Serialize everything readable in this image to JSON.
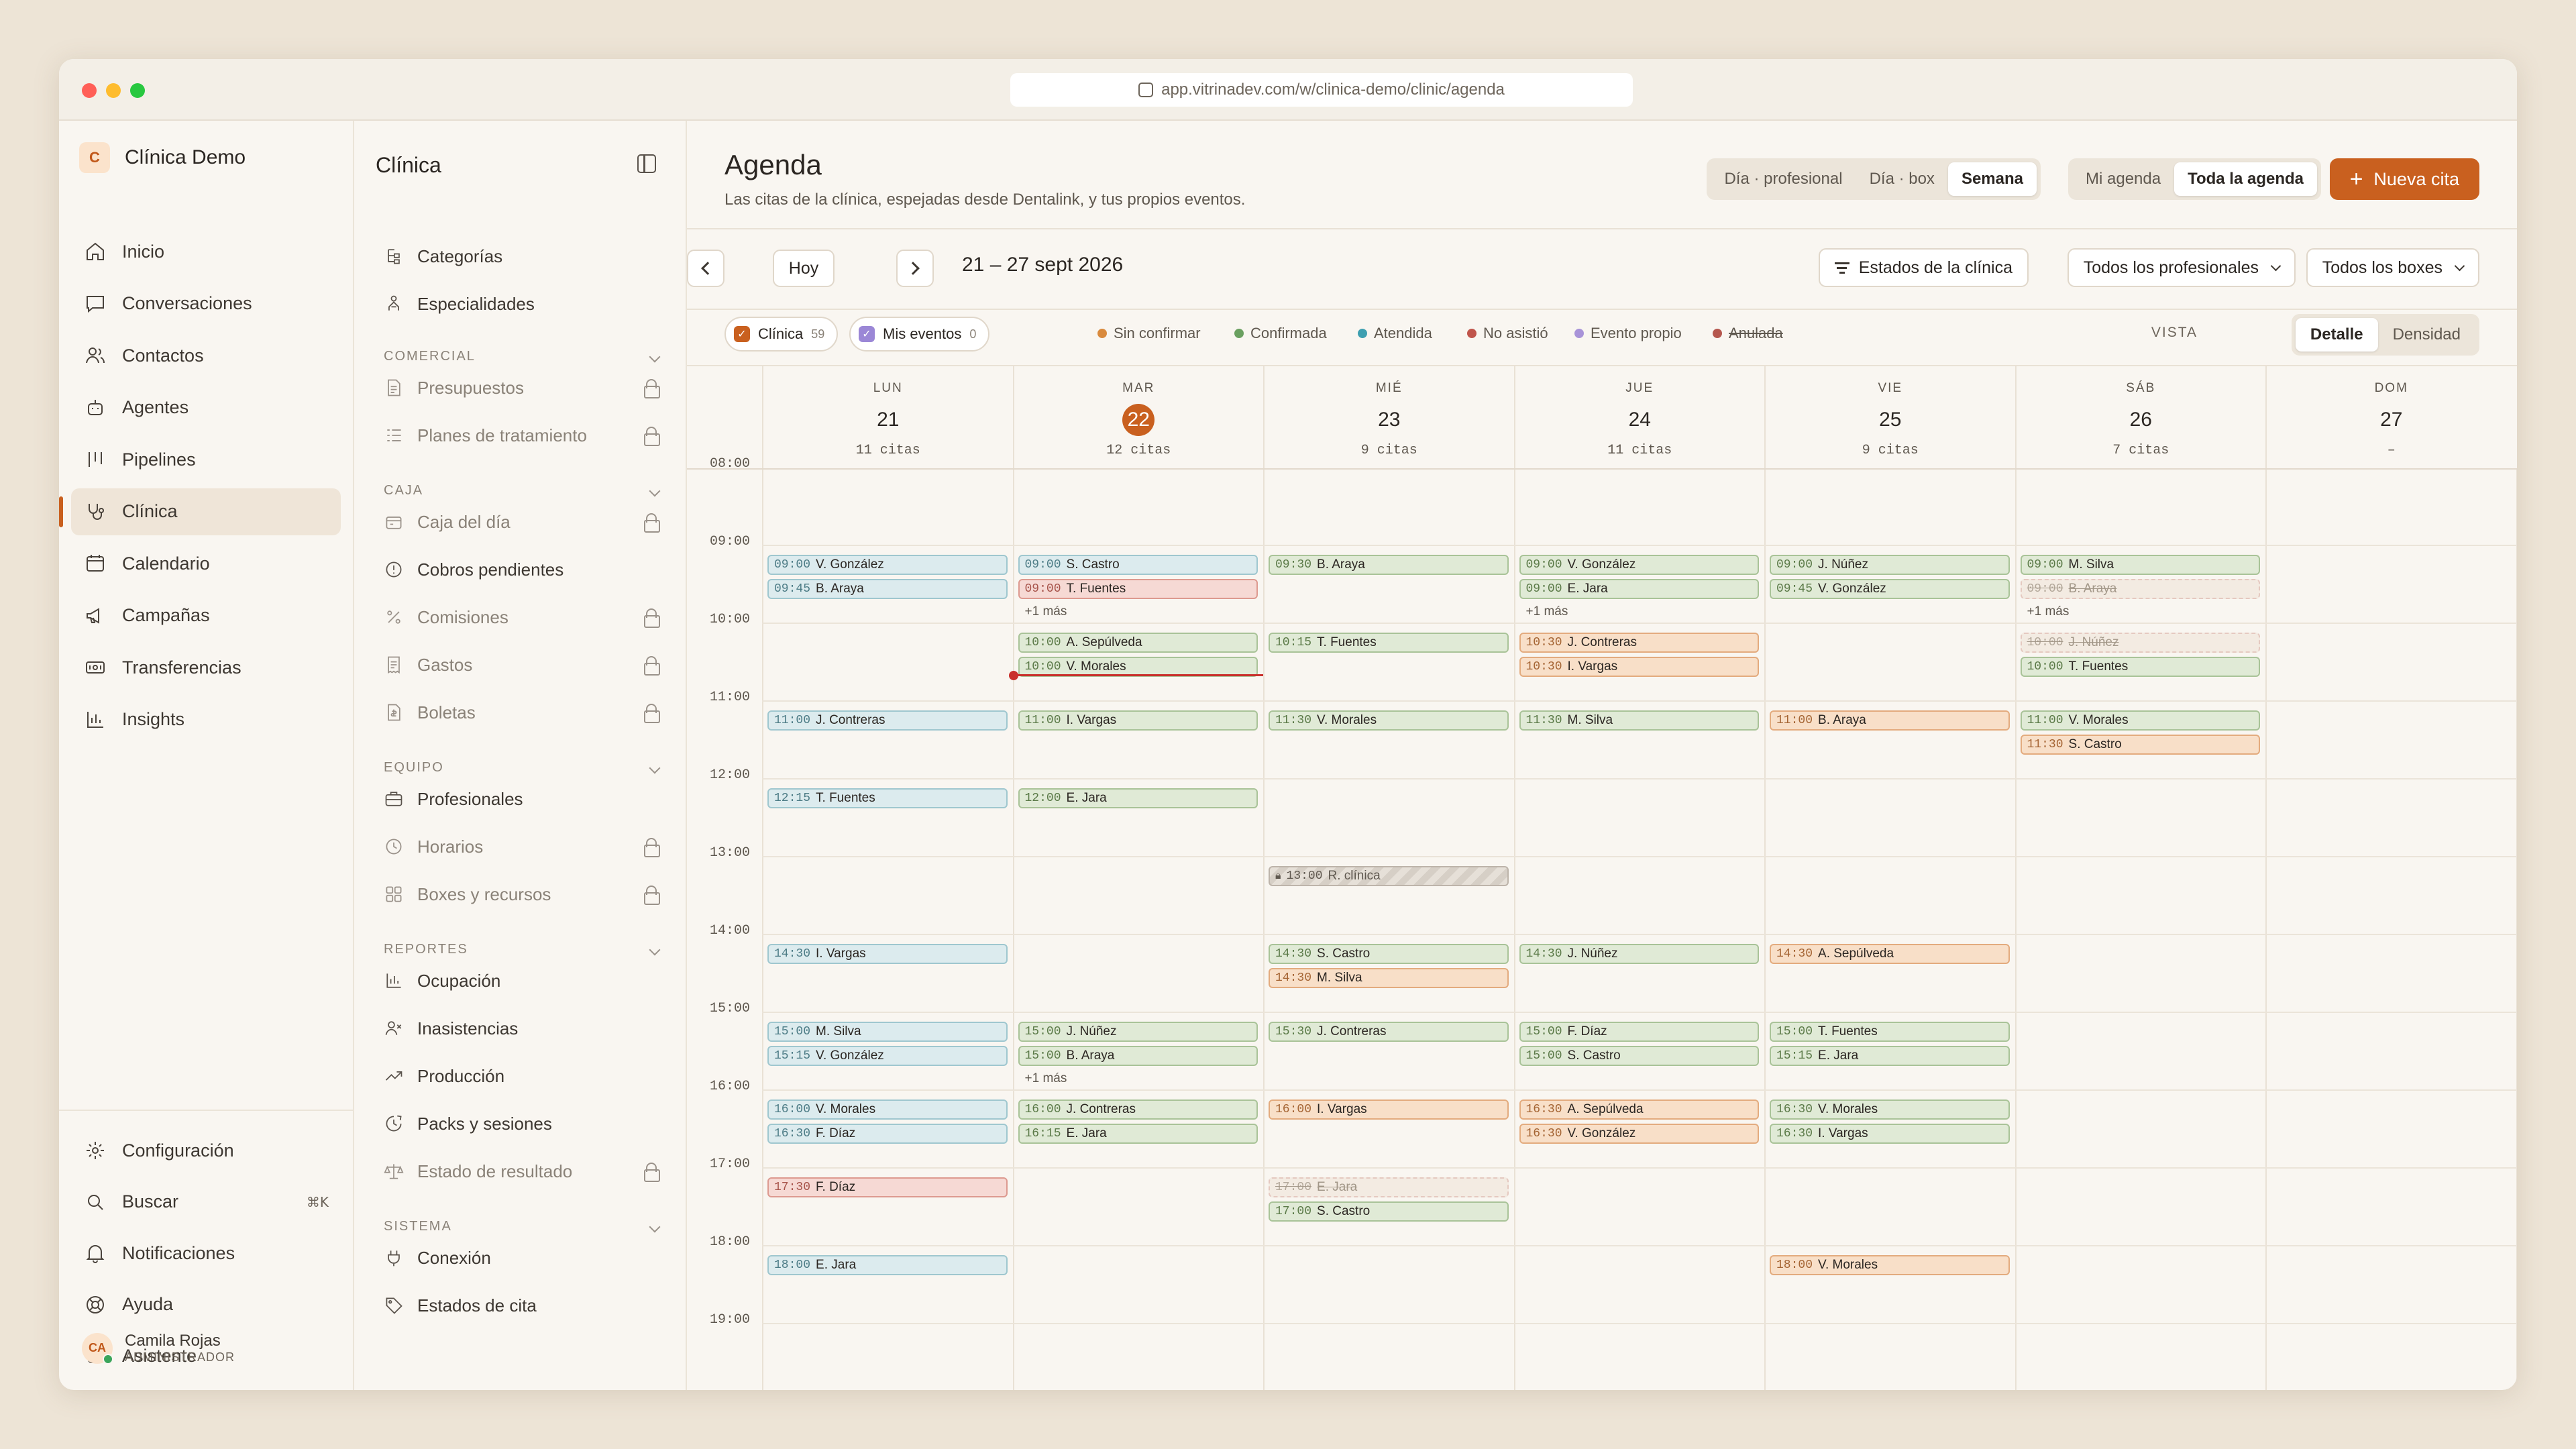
{
  "browser": {
    "url": "app.vitrinadev.com/w/clinica-demo/clinic/agenda"
  },
  "brand": {
    "initial": "C",
    "name": "Clínica Demo"
  },
  "nav": [
    {
      "label": "Inicio",
      "icon": "home-icon"
    },
    {
      "label": "Conversaciones",
      "icon": "chat-icon"
    },
    {
      "label": "Contactos",
      "icon": "users-icon"
    },
    {
      "label": "Agentes",
      "icon": "bot-icon"
    },
    {
      "label": "Pipelines",
      "icon": "columns-icon"
    },
    {
      "label": "Clínica",
      "icon": "stethoscope-icon",
      "active": true
    },
    {
      "label": "Calendario",
      "icon": "calendar-icon"
    },
    {
      "label": "Campañas",
      "icon": "megaphone-icon"
    },
    {
      "label": "Transferencias",
      "icon": "transfer-icon"
    },
    {
      "label": "Insights",
      "icon": "bar-chart-icon"
    }
  ],
  "nav_bottom": [
    {
      "label": "Configuración",
      "icon": "gear-icon"
    },
    {
      "label": "Buscar",
      "icon": "search-icon",
      "shortcut": "⌘K"
    },
    {
      "label": "Notificaciones",
      "icon": "bell-icon"
    },
    {
      "label": "Ayuda",
      "icon": "help-icon"
    },
    {
      "label": "Asistente",
      "icon": "bot-icon"
    }
  ],
  "user": {
    "initials": "CA",
    "name": "Camila Rojas",
    "role": "ADMINISTRADOR"
  },
  "sub": {
    "title": "Clínica",
    "top_items": [
      {
        "label": "Categorías",
        "icon": "tree-icon"
      },
      {
        "label": "Especialidades",
        "icon": "specialty-icon"
      }
    ],
    "sections": [
      {
        "title": "COMERCIAL",
        "items": [
          {
            "label": "Presupuestos",
            "icon": "document-icon",
            "locked": true
          },
          {
            "label": "Planes de tratamiento",
            "icon": "list-icon",
            "locked": true
          }
        ]
      },
      {
        "title": "CAJA",
        "items": [
          {
            "label": "Caja del día",
            "icon": "cashbox-icon",
            "locked": true
          },
          {
            "label": "Cobros pendientes",
            "icon": "alert-circle-icon",
            "locked": false
          },
          {
            "label": "Comisiones",
            "icon": "percent-icon",
            "locked": true
          },
          {
            "label": "Gastos",
            "icon": "receipt-icon",
            "locked": true
          },
          {
            "label": "Boletas",
            "icon": "invoice-icon",
            "locked": true
          }
        ]
      },
      {
        "title": "EQUIPO",
        "items": [
          {
            "label": "Profesionales",
            "icon": "briefcase-icon",
            "locked": false
          },
          {
            "label": "Horarios",
            "icon": "clock-icon",
            "locked": true
          },
          {
            "label": "Boxes y recursos",
            "icon": "grid-icon",
            "locked": true
          }
        ]
      },
      {
        "title": "REPORTES",
        "items": [
          {
            "label": "Ocupación",
            "icon": "bar-chart-icon",
            "locked": false
          },
          {
            "label": "Inasistencias",
            "icon": "user-x-icon",
            "locked": false
          },
          {
            "label": "Producción",
            "icon": "trend-icon",
            "locked": false
          },
          {
            "label": "Packs y sesiones",
            "icon": "clock-arrow-icon",
            "locked": false
          },
          {
            "label": "Estado de resultado",
            "icon": "scale-icon",
            "locked": true
          }
        ]
      },
      {
        "title": "SISTEMA",
        "items": [
          {
            "label": "Conexión",
            "icon": "plug-icon",
            "locked": false
          },
          {
            "label": "Estados de cita",
            "icon": "tag-icon",
            "locked": false
          }
        ]
      }
    ]
  },
  "page": {
    "title": "Agenda",
    "subtitle": "Las citas de la clínica, espejadas desde Dentalink, y tus propios eventos."
  },
  "view_seg": [
    "Día · profesional",
    "Día · box",
    "Semana"
  ],
  "view_seg_selected": "Semana",
  "scope_seg": [
    "Mi agenda",
    "Toda la agenda"
  ],
  "scope_seg_selected": "Toda la agenda",
  "new_button": "Nueva cita",
  "toolbar": {
    "today": "Hoy",
    "range": "21 – 27 sept 2026",
    "estados": "Estados de la clínica",
    "profesionales": "Todos los profesionales",
    "boxes": "Todos los boxes"
  },
  "chips": [
    {
      "label": "Clínica",
      "count": "59",
      "color": "#c9601f"
    },
    {
      "label": "Mis eventos",
      "count": "0",
      "color": "#9b87d6"
    }
  ],
  "legend": [
    {
      "label": "Sin confirmar",
      "color": "#d98a3d"
    },
    {
      "label": "Confirmada",
      "color": "#6aa060"
    },
    {
      "label": "Atendida",
      "color": "#3e9fb0"
    },
    {
      "label": "No asistió",
      "color": "#c0554b"
    },
    {
      "label": "Evento propio",
      "color": "#a893d8"
    },
    {
      "label": "Anulada",
      "color": "#b5574e",
      "strike": true
    }
  ],
  "vista": {
    "label": "VISTA",
    "options": [
      "Detalle",
      "Densidad"
    ],
    "selected": "Detalle"
  },
  "days": [
    {
      "name": "LUN",
      "num": "21",
      "count": "11 citas"
    },
    {
      "name": "MAR",
      "num": "22",
      "count": "12 citas",
      "today": true
    },
    {
      "name": "MIÉ",
      "num": "23",
      "count": "9 citas"
    },
    {
      "name": "JUE",
      "num": "24",
      "count": "11 citas"
    },
    {
      "name": "VIE",
      "num": "25",
      "count": "9 citas"
    },
    {
      "name": "SÁB",
      "num": "26",
      "count": "7 citas"
    },
    {
      "name": "DOM",
      "num": "27",
      "count": "–"
    }
  ],
  "hours": [
    "08:00",
    "09:00",
    "10:00",
    "11:00",
    "12:00",
    "13:00",
    "14:00",
    "15:00",
    "16:00",
    "17:00",
    "18:00",
    "19:00"
  ],
  "now": {
    "day": 1,
    "time": "10:40"
  },
  "events": [
    {
      "day": 0,
      "time": "09:00",
      "name": "V. González",
      "status": "blue"
    },
    {
      "day": 0,
      "time": "09:45",
      "name": "B. Araya",
      "status": "blue"
    },
    {
      "day": 0,
      "time": "11:00",
      "name": "J. Contreras",
      "status": "blue"
    },
    {
      "day": 0,
      "time": "12:15",
      "name": "T. Fuentes",
      "status": "blue"
    },
    {
      "day": 0,
      "time": "14:30",
      "name": "I. Vargas",
      "status": "blue"
    },
    {
      "day": 0,
      "time": "15:00",
      "name": "M. Silva",
      "status": "blue"
    },
    {
      "day": 0,
      "time": "15:15",
      "name": "V. González",
      "status": "blue"
    },
    {
      "day": 0,
      "time": "16:00",
      "name": "V. Morales",
      "status": "blue"
    },
    {
      "day": 0,
      "time": "16:30",
      "name": "F. Díaz",
      "status": "blue"
    },
    {
      "day": 0,
      "time": "17:30",
      "name": "F. Díaz",
      "status": "red"
    },
    {
      "day": 0,
      "time": "18:00",
      "name": "E. Jara",
      "status": "blue"
    },
    {
      "day": 1,
      "time": "09:00",
      "name": "S. Castro",
      "status": "blue"
    },
    {
      "day": 1,
      "time": "09:00",
      "name": "T. Fuentes",
      "status": "red"
    },
    {
      "day": 1,
      "time": "10:00",
      "name": "A. Sepúlveda",
      "status": "green"
    },
    {
      "day": 1,
      "time": "10:00",
      "name": "V. Morales",
      "status": "green"
    },
    {
      "day": 1,
      "time": "11:00",
      "name": "I. Vargas",
      "status": "green"
    },
    {
      "day": 1,
      "time": "12:00",
      "name": "E. Jara",
      "status": "green"
    },
    {
      "day": 1,
      "time": "15:00",
      "name": "J. Núñez",
      "status": "green"
    },
    {
      "day": 1,
      "time": "15:00",
      "name": "B. Araya",
      "status": "green"
    },
    {
      "day": 1,
      "time": "16:00",
      "name": "J. Contreras",
      "status": "green"
    },
    {
      "day": 1,
      "time": "16:15",
      "name": "E. Jara",
      "status": "green"
    },
    {
      "day": 2,
      "time": "09:30",
      "name": "B. Araya",
      "status": "green"
    },
    {
      "day": 2,
      "time": "10:15",
      "name": "T. Fuentes",
      "status": "green"
    },
    {
      "day": 2,
      "time": "11:30",
      "name": "V. Morales",
      "status": "green"
    },
    {
      "day": 2,
      "time": "13:00",
      "name": "R. clínica",
      "status": "block"
    },
    {
      "day": 2,
      "time": "14:30",
      "name": "S. Castro",
      "status": "green"
    },
    {
      "day": 2,
      "time": "14:30",
      "name": "M. Silva",
      "status": "orange"
    },
    {
      "day": 2,
      "time": "15:30",
      "name": "J. Contreras",
      "status": "green"
    },
    {
      "day": 2,
      "time": "16:00",
      "name": "I. Vargas",
      "status": "orange"
    },
    {
      "day": 2,
      "time": "17:00",
      "name": "E. Jara",
      "status": "cancel"
    },
    {
      "day": 2,
      "time": "17:00",
      "name": "S. Castro",
      "status": "green"
    },
    {
      "day": 3,
      "time": "09:00",
      "name": "V. González",
      "status": "green"
    },
    {
      "day": 3,
      "time": "09:00",
      "name": "E. Jara",
      "status": "green"
    },
    {
      "day": 3,
      "time": "10:30",
      "name": "J. Contreras",
      "status": "orange"
    },
    {
      "day": 3,
      "time": "10:30",
      "name": "I. Vargas",
      "status": "orange"
    },
    {
      "day": 3,
      "time": "11:30",
      "name": "M. Silva",
      "status": "green"
    },
    {
      "day": 3,
      "time": "14:30",
      "name": "J. Núñez",
      "status": "green"
    },
    {
      "day": 3,
      "time": "15:00",
      "name": "F. Díaz",
      "status": "green"
    },
    {
      "day": 3,
      "time": "15:00",
      "name": "S. Castro",
      "status": "green"
    },
    {
      "day": 3,
      "time": "16:30",
      "name": "A. Sepúlveda",
      "status": "orange"
    },
    {
      "day": 3,
      "time": "16:30",
      "name": "V. González",
      "status": "orange"
    },
    {
      "day": 4,
      "time": "09:00",
      "name": "J. Núñez",
      "status": "green"
    },
    {
      "day": 4,
      "time": "09:45",
      "name": "V. González",
      "status": "green"
    },
    {
      "day": 4,
      "time": "11:00",
      "name": "B. Araya",
      "status": "orange"
    },
    {
      "day": 4,
      "time": "14:30",
      "name": "A. Sepúlveda",
      "status": "orange"
    },
    {
      "day": 4,
      "time": "15:00",
      "name": "T. Fuentes",
      "status": "green"
    },
    {
      "day": 4,
      "time": "15:15",
      "name": "E. Jara",
      "status": "green"
    },
    {
      "day": 4,
      "time": "16:30",
      "name": "V. Morales",
      "status": "green"
    },
    {
      "day": 4,
      "time": "16:30",
      "name": "I. Vargas",
      "status": "green"
    },
    {
      "day": 4,
      "time": "18:00",
      "name": "V. Morales",
      "status": "orange"
    },
    {
      "day": 5,
      "time": "09:00",
      "name": "M. Silva",
      "status": "green"
    },
    {
      "day": 5,
      "time": "09:00",
      "name": "B. Araya",
      "status": "cancel"
    },
    {
      "day": 5,
      "time": "10:00",
      "name": "J. Núñez",
      "status": "cancel"
    },
    {
      "day": 5,
      "time": "10:00",
      "name": "T. Fuentes",
      "status": "green"
    },
    {
      "day": 5,
      "time": "11:00",
      "name": "V. Morales",
      "status": "green"
    },
    {
      "day": 5,
      "time": "11:30",
      "name": "S. Castro",
      "status": "orange"
    }
  ],
  "more": [
    {
      "day": 1,
      "hour": "09:00",
      "label": "+1 más"
    },
    {
      "day": 3,
      "hour": "09:00",
      "label": "+1 más"
    },
    {
      "day": 5,
      "hour": "09:00",
      "label": "+1 más"
    },
    {
      "day": 1,
      "hour": "15:00",
      "label": "+1 más"
    }
  ]
}
